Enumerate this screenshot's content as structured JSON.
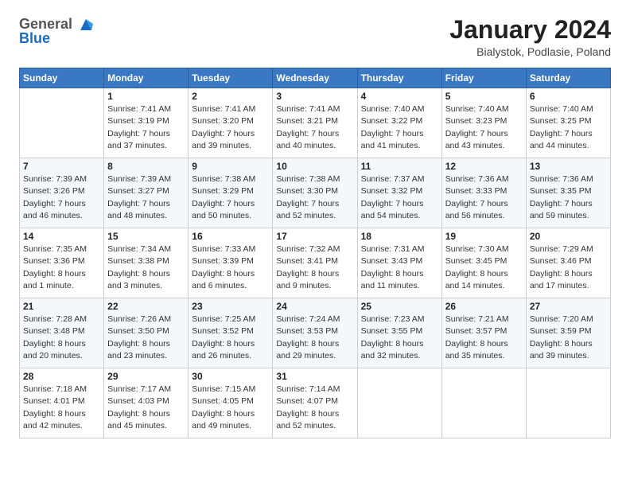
{
  "logo": {
    "line1": "General",
    "line2": "Blue"
  },
  "title": "January 2024",
  "subtitle": "Bialystok, Podlasie, Poland",
  "days_header": [
    "Sunday",
    "Monday",
    "Tuesday",
    "Wednesday",
    "Thursday",
    "Friday",
    "Saturday"
  ],
  "weeks": [
    [
      {
        "num": "",
        "info": ""
      },
      {
        "num": "1",
        "info": "Sunrise: 7:41 AM\nSunset: 3:19 PM\nDaylight: 7 hours\nand 37 minutes."
      },
      {
        "num": "2",
        "info": "Sunrise: 7:41 AM\nSunset: 3:20 PM\nDaylight: 7 hours\nand 39 minutes."
      },
      {
        "num": "3",
        "info": "Sunrise: 7:41 AM\nSunset: 3:21 PM\nDaylight: 7 hours\nand 40 minutes."
      },
      {
        "num": "4",
        "info": "Sunrise: 7:40 AM\nSunset: 3:22 PM\nDaylight: 7 hours\nand 41 minutes."
      },
      {
        "num": "5",
        "info": "Sunrise: 7:40 AM\nSunset: 3:23 PM\nDaylight: 7 hours\nand 43 minutes."
      },
      {
        "num": "6",
        "info": "Sunrise: 7:40 AM\nSunset: 3:25 PM\nDaylight: 7 hours\nand 44 minutes."
      }
    ],
    [
      {
        "num": "7",
        "info": "Sunrise: 7:39 AM\nSunset: 3:26 PM\nDaylight: 7 hours\nand 46 minutes."
      },
      {
        "num": "8",
        "info": "Sunrise: 7:39 AM\nSunset: 3:27 PM\nDaylight: 7 hours\nand 48 minutes."
      },
      {
        "num": "9",
        "info": "Sunrise: 7:38 AM\nSunset: 3:29 PM\nDaylight: 7 hours\nand 50 minutes."
      },
      {
        "num": "10",
        "info": "Sunrise: 7:38 AM\nSunset: 3:30 PM\nDaylight: 7 hours\nand 52 minutes."
      },
      {
        "num": "11",
        "info": "Sunrise: 7:37 AM\nSunset: 3:32 PM\nDaylight: 7 hours\nand 54 minutes."
      },
      {
        "num": "12",
        "info": "Sunrise: 7:36 AM\nSunset: 3:33 PM\nDaylight: 7 hours\nand 56 minutes."
      },
      {
        "num": "13",
        "info": "Sunrise: 7:36 AM\nSunset: 3:35 PM\nDaylight: 7 hours\nand 59 minutes."
      }
    ],
    [
      {
        "num": "14",
        "info": "Sunrise: 7:35 AM\nSunset: 3:36 PM\nDaylight: 8 hours\nand 1 minute."
      },
      {
        "num": "15",
        "info": "Sunrise: 7:34 AM\nSunset: 3:38 PM\nDaylight: 8 hours\nand 3 minutes."
      },
      {
        "num": "16",
        "info": "Sunrise: 7:33 AM\nSunset: 3:39 PM\nDaylight: 8 hours\nand 6 minutes."
      },
      {
        "num": "17",
        "info": "Sunrise: 7:32 AM\nSunset: 3:41 PM\nDaylight: 8 hours\nand 9 minutes."
      },
      {
        "num": "18",
        "info": "Sunrise: 7:31 AM\nSunset: 3:43 PM\nDaylight: 8 hours\nand 11 minutes."
      },
      {
        "num": "19",
        "info": "Sunrise: 7:30 AM\nSunset: 3:45 PM\nDaylight: 8 hours\nand 14 minutes."
      },
      {
        "num": "20",
        "info": "Sunrise: 7:29 AM\nSunset: 3:46 PM\nDaylight: 8 hours\nand 17 minutes."
      }
    ],
    [
      {
        "num": "21",
        "info": "Sunrise: 7:28 AM\nSunset: 3:48 PM\nDaylight: 8 hours\nand 20 minutes."
      },
      {
        "num": "22",
        "info": "Sunrise: 7:26 AM\nSunset: 3:50 PM\nDaylight: 8 hours\nand 23 minutes."
      },
      {
        "num": "23",
        "info": "Sunrise: 7:25 AM\nSunset: 3:52 PM\nDaylight: 8 hours\nand 26 minutes."
      },
      {
        "num": "24",
        "info": "Sunrise: 7:24 AM\nSunset: 3:53 PM\nDaylight: 8 hours\nand 29 minutes."
      },
      {
        "num": "25",
        "info": "Sunrise: 7:23 AM\nSunset: 3:55 PM\nDaylight: 8 hours\nand 32 minutes."
      },
      {
        "num": "26",
        "info": "Sunrise: 7:21 AM\nSunset: 3:57 PM\nDaylight: 8 hours\nand 35 minutes."
      },
      {
        "num": "27",
        "info": "Sunrise: 7:20 AM\nSunset: 3:59 PM\nDaylight: 8 hours\nand 39 minutes."
      }
    ],
    [
      {
        "num": "28",
        "info": "Sunrise: 7:18 AM\nSunset: 4:01 PM\nDaylight: 8 hours\nand 42 minutes."
      },
      {
        "num": "29",
        "info": "Sunrise: 7:17 AM\nSunset: 4:03 PM\nDaylight: 8 hours\nand 45 minutes."
      },
      {
        "num": "30",
        "info": "Sunrise: 7:15 AM\nSunset: 4:05 PM\nDaylight: 8 hours\nand 49 minutes."
      },
      {
        "num": "31",
        "info": "Sunrise: 7:14 AM\nSunset: 4:07 PM\nDaylight: 8 hours\nand 52 minutes."
      },
      {
        "num": "",
        "info": ""
      },
      {
        "num": "",
        "info": ""
      },
      {
        "num": "",
        "info": ""
      }
    ]
  ]
}
